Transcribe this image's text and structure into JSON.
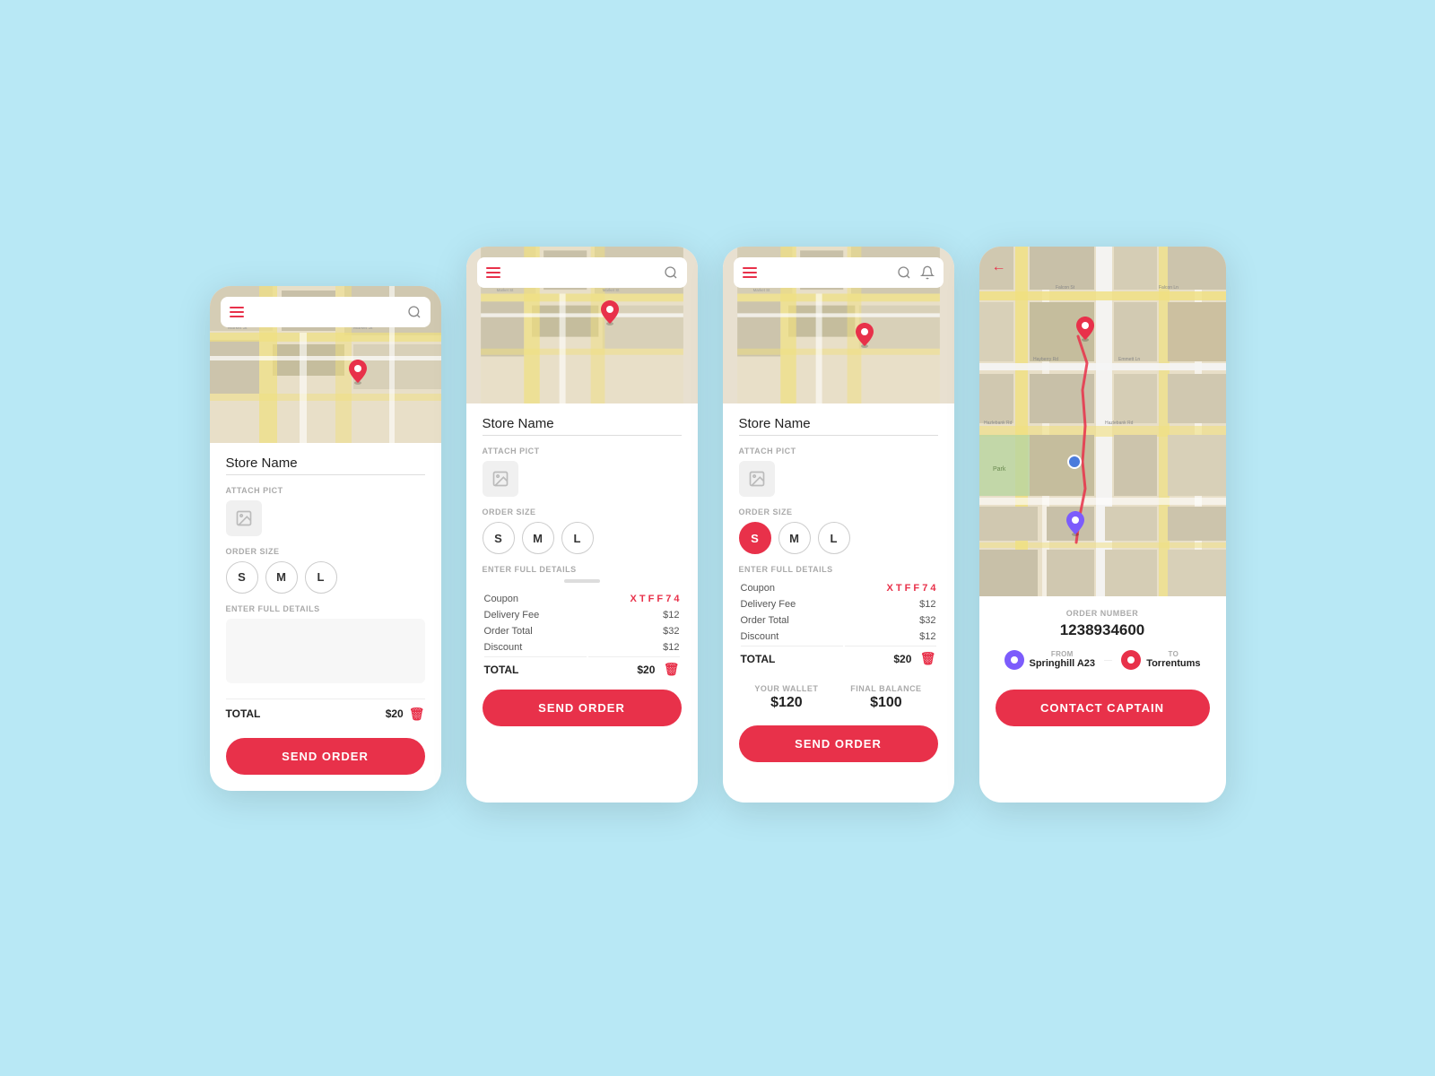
{
  "background": "#b8e8f5",
  "accent": "#e8314a",
  "phone1": {
    "store_name": "Store Name",
    "attach_label": "ATTACH PICT",
    "order_size_label": "ORDER SIZE",
    "sizes": [
      "S",
      "M",
      "L"
    ],
    "details_label": "ENTER FULL DETAILS",
    "details_placeholder": "",
    "total_label": "TOTAL",
    "total_value": "$20",
    "send_button": "SEND ORDER"
  },
  "phone2": {
    "store_name": "Store Name",
    "attach_label": "ATTACH PICT",
    "order_size_label": "ORDER SIZE",
    "sizes": [
      "S",
      "M",
      "L"
    ],
    "details_label": "ENTER FULL DETAILS",
    "coupon_label": "Coupon",
    "coupon_code": "X T F F 7 4",
    "delivery_fee_label": "Delivery Fee",
    "delivery_fee": "$12",
    "order_total_label": "Order Total",
    "order_total": "$32",
    "discount_label": "Discount",
    "discount": "$12",
    "total_label": "TOTAL",
    "total_value": "$20",
    "send_button": "SEND ORDER"
  },
  "phone3": {
    "store_name": "Store Name",
    "attach_label": "ATTACH PICT",
    "order_size_label": "ORDER SIZE",
    "sizes": [
      "S",
      "M",
      "L"
    ],
    "details_label": "ENTER FULL DETAILS",
    "coupon_label": "Coupon",
    "coupon_code": "X T F F 7 4",
    "delivery_fee_label": "Delivery Fee",
    "delivery_fee": "$12",
    "order_total_label": "Order Total",
    "order_total": "$32",
    "discount_label": "Discount",
    "discount": "$12",
    "total_label": "TOTAL",
    "total_value": "$20",
    "wallet_label": "YOUR WALLET",
    "wallet_value": "$120",
    "final_balance_label": "FINAL BALANCE",
    "final_balance_value": "$100",
    "send_button": "SEND ORDER"
  },
  "phone4": {
    "order_number_label": "ORDER NUMBER",
    "order_number": "1238934600",
    "from_label": "FROM",
    "from_value": "Springhill A23",
    "to_label": "TO",
    "to_value": "Torrentums",
    "contact_button": "CONTACT CAPTAIN"
  }
}
